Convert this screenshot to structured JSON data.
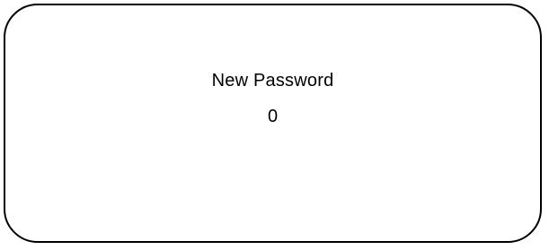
{
  "screen": {
    "title": "New Password",
    "value": "0"
  }
}
